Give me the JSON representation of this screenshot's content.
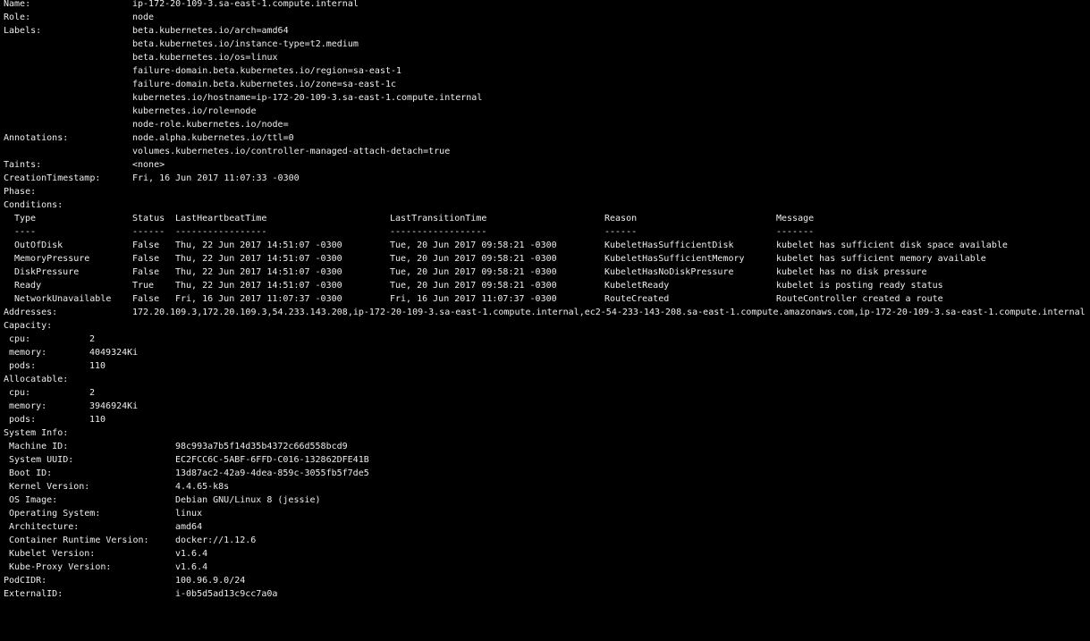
{
  "name": {
    "label": "Name:",
    "value": "ip-172-20-109-3.sa-east-1.compute.internal"
  },
  "role": {
    "label": "Role:",
    "value": "node"
  },
  "labels": {
    "label": "Labels:",
    "items": [
      "beta.kubernetes.io/arch=amd64",
      "beta.kubernetes.io/instance-type=t2.medium",
      "beta.kubernetes.io/os=linux",
      "failure-domain.beta.kubernetes.io/region=sa-east-1",
      "failure-domain.beta.kubernetes.io/zone=sa-east-1c",
      "kubernetes.io/hostname=ip-172-20-109-3.sa-east-1.compute.internal",
      "kubernetes.io/role=node",
      "node-role.kubernetes.io/node="
    ]
  },
  "annotations": {
    "label": "Annotations:",
    "items": [
      "node.alpha.kubernetes.io/ttl=0",
      "volumes.kubernetes.io/controller-managed-attach-detach=true"
    ]
  },
  "taints": {
    "label": "Taints:",
    "value": "<none>"
  },
  "creation": {
    "label": "CreationTimestamp:",
    "value": "Fri, 16 Jun 2017 11:07:33 -0300"
  },
  "phase": {
    "label": "Phase:",
    "value": ""
  },
  "conditions": {
    "label": "Conditions:",
    "headers": [
      "Type",
      "Status",
      "LastHeartbeatTime",
      "LastTransitionTime",
      "Reason",
      "Message"
    ],
    "separators": [
      "----",
      "------",
      "-----------------",
      "------------------",
      "------",
      "-------"
    ],
    "rows": [
      [
        "OutOfDisk",
        "False",
        "Thu, 22 Jun 2017 14:51:07 -0300",
        "Tue, 20 Jun 2017 09:58:21 -0300",
        "KubeletHasSufficientDisk",
        "kubelet has sufficient disk space available"
      ],
      [
        "MemoryPressure",
        "False",
        "Thu, 22 Jun 2017 14:51:07 -0300",
        "Tue, 20 Jun 2017 09:58:21 -0300",
        "KubeletHasSufficientMemory",
        "kubelet has sufficient memory available"
      ],
      [
        "DiskPressure",
        "False",
        "Thu, 22 Jun 2017 14:51:07 -0300",
        "Tue, 20 Jun 2017 09:58:21 -0300",
        "KubeletHasNoDiskPressure",
        "kubelet has no disk pressure"
      ],
      [
        "Ready",
        "True",
        "Thu, 22 Jun 2017 14:51:07 -0300",
        "Tue, 20 Jun 2017 09:58:21 -0300",
        "KubeletReady",
        "kubelet is posting ready status"
      ],
      [
        "NetworkUnavailable",
        "False",
        "Fri, 16 Jun 2017 11:07:37 -0300",
        "Fri, 16 Jun 2017 11:07:37 -0300",
        "RouteCreated",
        "RouteController created a route"
      ]
    ]
  },
  "addresses": {
    "label": "Addresses:",
    "value": "172.20.109.3,172.20.109.3,54.233.143.208,ip-172-20-109-3.sa-east-1.compute.internal,ec2-54-233-143-208.sa-east-1.compute.amazonaws.com,ip-172-20-109-3.sa-east-1.compute.internal"
  },
  "capacity": {
    "label": "Capacity:",
    "items": [
      {
        "key": "cpu:",
        "value": "2"
      },
      {
        "key": "memory:",
        "value": "4049324Ki"
      },
      {
        "key": "pods:",
        "value": "110"
      }
    ]
  },
  "allocatable": {
    "label": "Allocatable:",
    "items": [
      {
        "key": "cpu:",
        "value": "2"
      },
      {
        "key": "memory:",
        "value": "3946924Ki"
      },
      {
        "key": "pods:",
        "value": "110"
      }
    ]
  },
  "system_info": {
    "label": "System Info:",
    "items": [
      {
        "key": "Machine ID:",
        "value": "98c993a7b5f14d35b4372c66d558bcd9"
      },
      {
        "key": "System UUID:",
        "value": "EC2FCC6C-5ABF-6FFD-C016-132862DFE41B"
      },
      {
        "key": "Boot ID:",
        "value": "13d87ac2-42a9-4dea-859c-3055fb5f7de5"
      },
      {
        "key": "Kernel Version:",
        "value": "4.4.65-k8s"
      },
      {
        "key": "OS Image:",
        "value": "Debian GNU/Linux 8 (jessie)"
      },
      {
        "key": "Operating System:",
        "value": "linux"
      },
      {
        "key": "Architecture:",
        "value": "amd64"
      },
      {
        "key": "Container Runtime Version:",
        "value": "docker://1.12.6"
      },
      {
        "key": "Kubelet Version:",
        "value": "v1.6.4"
      },
      {
        "key": "Kube-Proxy Version:",
        "value": "v1.6.4"
      }
    ]
  },
  "pod_cidr": {
    "label": "PodCIDR:",
    "value": "100.96.9.0/24"
  },
  "external_id": {
    "label": "ExternalID:",
    "value": "i-0b5d5ad13c9cc7a0a"
  }
}
